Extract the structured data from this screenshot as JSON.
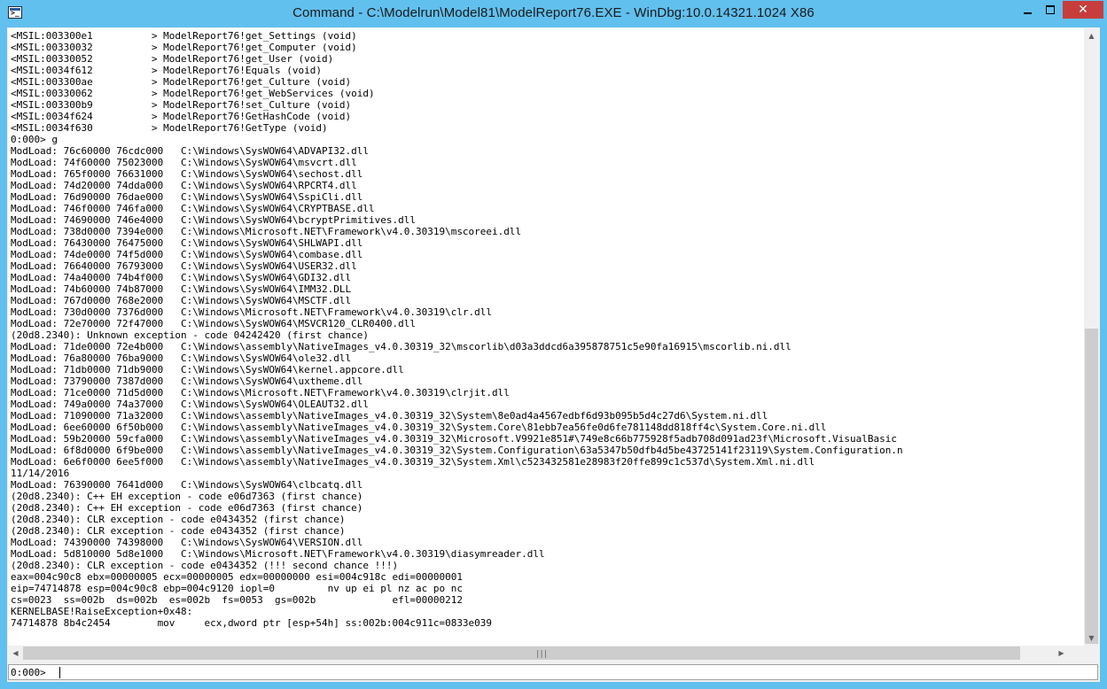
{
  "window": {
    "title": "Command - C:\\Modelrun\\Model81\\ModelReport76.EXE - WinDbg:10.0.14321.1024 X86",
    "icon": "console-icon",
    "minimize_icon": "minimize-icon",
    "maximize_icon": "maximize-icon",
    "close_icon": "close-icon",
    "close_glyph": "✕"
  },
  "output": {
    "lines": [
      "<MSIL:003300e1          > ModelReport76!get_Settings (void)",
      "<MSIL:00330032          > ModelReport76!get_Computer (void)",
      "<MSIL:00330052          > ModelReport76!get_User (void)",
      "<MSIL:0034f612          > ModelReport76!Equals (void)",
      "<MSIL:003300ae          > ModelReport76!get_Culture (void)",
      "<MSIL:00330062          > ModelReport76!get_WebServices (void)",
      "<MSIL:003300b9          > ModelReport76!set_Culture (void)",
      "<MSIL:0034f624          > ModelReport76!GetHashCode (void)",
      "<MSIL:0034f630          > ModelReport76!GetType (void)",
      "0:000> g",
      "ModLoad: 76c60000 76cdc000   C:\\Windows\\SysWOW64\\ADVAPI32.dll",
      "ModLoad: 74f60000 75023000   C:\\Windows\\SysWOW64\\msvcrt.dll",
      "ModLoad: 765f0000 76631000   C:\\Windows\\SysWOW64\\sechost.dll",
      "ModLoad: 74d20000 74dda000   C:\\Windows\\SysWOW64\\RPCRT4.dll",
      "ModLoad: 76d90000 76dae000   C:\\Windows\\SysWOW64\\SspiCli.dll",
      "ModLoad: 746f0000 746fa000   C:\\Windows\\SysWOW64\\CRYPTBASE.dll",
      "ModLoad: 74690000 746e4000   C:\\Windows\\SysWOW64\\bcryptPrimitives.dll",
      "ModLoad: 738d0000 7394e000   C:\\Windows\\Microsoft.NET\\Framework\\v4.0.30319\\mscoreei.dll",
      "ModLoad: 76430000 76475000   C:\\Windows\\SysWOW64\\SHLWAPI.dll",
      "ModLoad: 74de0000 74f5d000   C:\\Windows\\SysWOW64\\combase.dll",
      "ModLoad: 76640000 76793000   C:\\Windows\\SysWOW64\\USER32.dll",
      "ModLoad: 74a40000 74b4f000   C:\\Windows\\SysWOW64\\GDI32.dll",
      "ModLoad: 74b60000 74b87000   C:\\Windows\\SysWOW64\\IMM32.DLL",
      "ModLoad: 767d0000 768e2000   C:\\Windows\\SysWOW64\\MSCTF.dll",
      "ModLoad: 730d0000 7376d000   C:\\Windows\\Microsoft.NET\\Framework\\v4.0.30319\\clr.dll",
      "ModLoad: 72e70000 72f47000   C:\\Windows\\SysWOW64\\MSVCR120_CLR0400.dll",
      "(20d8.2340): Unknown exception - code 04242420 (first chance)",
      "ModLoad: 71de0000 72e4b000   C:\\Windows\\assembly\\NativeImages_v4.0.30319_32\\mscorlib\\d03a3ddcd6a395878751c5e90fa16915\\mscorlib.ni.dll",
      "ModLoad: 76a80000 76ba9000   C:\\Windows\\SysWOW64\\ole32.dll",
      "ModLoad: 71db0000 71db9000   C:\\Windows\\SysWOW64\\kernel.appcore.dll",
      "ModLoad: 73790000 7387d000   C:\\Windows\\SysWOW64\\uxtheme.dll",
      "ModLoad: 71ce0000 71d5d000   C:\\Windows\\Microsoft.NET\\Framework\\v4.0.30319\\clrjit.dll",
      "ModLoad: 749a0000 74a37000   C:\\Windows\\SysWOW64\\OLEAUT32.dll",
      "ModLoad: 71090000 71a32000   C:\\Windows\\assembly\\NativeImages_v4.0.30319_32\\System\\8e0ad4a4567edbf6d93b095b5d4c27d6\\System.ni.dll",
      "ModLoad: 6ee60000 6f50b000   C:\\Windows\\assembly\\NativeImages_v4.0.30319_32\\System.Core\\81ebb7ea56fe0d6fe781148dd818ff4c\\System.Core.ni.dll",
      "ModLoad: 59b20000 59cfa000   C:\\Windows\\assembly\\NativeImages_v4.0.30319_32\\Microsoft.V9921e851#\\749e8c66b775928f5adb708d091ad23f\\Microsoft.VisualBasic",
      "ModLoad: 6f8d0000 6f9be000   C:\\Windows\\assembly\\NativeImages_v4.0.30319_32\\System.Configuration\\63a5347b50dfb4d5be43725141f23119\\System.Configuration.n",
      "ModLoad: 6e6f0000 6ee5f000   C:\\Windows\\assembly\\NativeImages_v4.0.30319_32\\System.Xml\\c523432581e28983f20ffe899c1c537d\\System.Xml.ni.dll",
      "11/14/2016",
      "ModLoad: 76390000 7641d000   C:\\Windows\\SysWOW64\\clbcatq.dll",
      "(20d8.2340): C++ EH exception - code e06d7363 (first chance)",
      "(20d8.2340): C++ EH exception - code e06d7363 (first chance)",
      "(20d8.2340): CLR exception - code e0434352 (first chance)",
      "(20d8.2340): CLR exception - code e0434352 (first chance)",
      "ModLoad: 74390000 74398000   C:\\Windows\\SysWOW64\\VERSION.dll",
      "ModLoad: 5d810000 5d8e1000   C:\\Windows\\Microsoft.NET\\Framework\\v4.0.30319\\diasymreader.dll",
      "(20d8.2340): CLR exception - code e0434352 (!!! second chance !!!)",
      "eax=004c90c8 ebx=00000005 ecx=00000005 edx=00000000 esi=004c918c edi=00000001",
      "eip=74714878 esp=004c90c8 ebp=004c9120 iopl=0         nv up ei pl nz ac po nc",
      "cs=0023  ss=002b  ds=002b  es=002b  fs=0053  gs=002b             efl=00000212",
      "KERNELBASE!RaiseException+0x48:",
      "74714878 8b4c2454        mov     ecx,dword ptr [esp+54h] ss:002b:004c911c=0833e039"
    ]
  },
  "scrollbars": {
    "up_icon": "arrow-up-icon",
    "up_glyph": "▲",
    "down_icon": "arrow-down-icon",
    "down_glyph": "▼",
    "left_icon": "arrow-left-icon",
    "left_glyph": "◀",
    "right_icon": "arrow-right-icon",
    "right_glyph": "▶",
    "grip_glyph": "|||"
  },
  "command": {
    "prompt": "0:000>",
    "value": "",
    "placeholder": ""
  }
}
